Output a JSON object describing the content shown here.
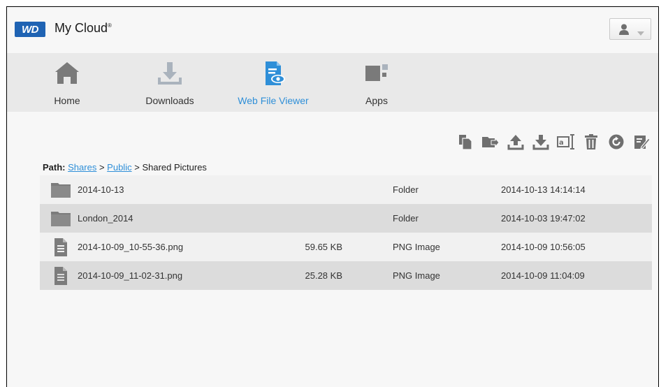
{
  "header": {
    "logo_text": "WD",
    "title": "My Cloud",
    "title_mark": "®",
    "user_icon": "user-icon"
  },
  "nav": {
    "items": [
      {
        "label": "Home",
        "icon": "home-icon",
        "active": false
      },
      {
        "label": "Downloads",
        "icon": "downloads-icon",
        "active": false
      },
      {
        "label": "Web File Viewer",
        "icon": "web-file-viewer-icon",
        "active": true
      },
      {
        "label": "Apps",
        "icon": "apps-icon",
        "active": false
      }
    ],
    "active_color": "#2f8fd8"
  },
  "toolbar": {
    "buttons": [
      {
        "icon": "copy-icon"
      },
      {
        "icon": "move-icon"
      },
      {
        "icon": "upload-icon"
      },
      {
        "icon": "download-icon"
      },
      {
        "icon": "rename-icon"
      },
      {
        "icon": "delete-icon"
      },
      {
        "icon": "refresh-icon"
      },
      {
        "icon": "edit-icon"
      }
    ]
  },
  "path": {
    "label": "Path:",
    "crumbs": [
      "Shares",
      "Public",
      "Shared Pictures"
    ],
    "separator": ">"
  },
  "files": [
    {
      "name": "2014-10-13",
      "size": "",
      "type": "Folder",
      "modified": "2014-10-13 14:14:14",
      "icon": "folder-icon"
    },
    {
      "name": "London_2014",
      "size": "",
      "type": "Folder",
      "modified": "2014-10-03 19:47:02",
      "icon": "folder-icon"
    },
    {
      "name": "2014-10-09_10-55-36.png",
      "size": "59.65 KB",
      "type": "PNG Image",
      "modified": "2014-10-09 10:56:05",
      "icon": "document-icon"
    },
    {
      "name": "2014-10-09_11-02-31.png",
      "size": "25.28 KB",
      "type": "PNG Image",
      "modified": "2014-10-09 11:04:09",
      "icon": "document-icon"
    }
  ],
  "colors": {
    "brand": "#1f63b3",
    "link": "#2f8fd8",
    "icon_gray": "#6f6f6f"
  }
}
